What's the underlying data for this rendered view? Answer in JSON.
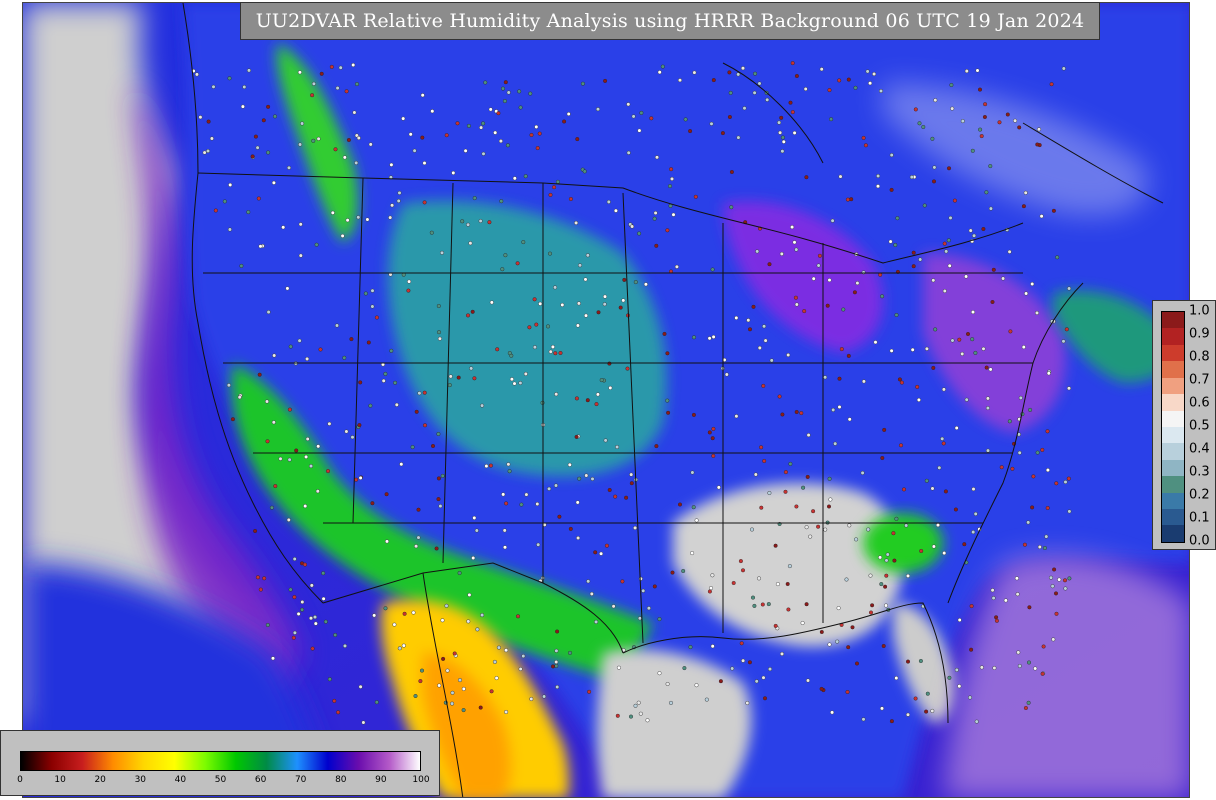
{
  "title": "UU2DVAR Relative Humidity Analysis using HRRR Background 06 UTC 19 Jan 2024",
  "colorbar": {
    "ticks": [
      "0",
      "10",
      "20",
      "30",
      "40",
      "50",
      "60",
      "70",
      "80",
      "90",
      "100"
    ],
    "stops": [
      "#000000",
      "#8b0000",
      "#c81e1e",
      "#ff8c00",
      "#ffd700",
      "#ffff00",
      "#7cfc00",
      "#00c800",
      "#008b45",
      "#1e90ff",
      "#0000cd",
      "#6a0dad",
      "#b45ac8",
      "#ffffff"
    ]
  },
  "legend": {
    "labels": [
      "1.0",
      "0.9",
      "0.8",
      "0.7",
      "0.6",
      "0.5",
      "0.4",
      "0.3",
      "0.2",
      "0.1",
      "0.0"
    ],
    "colors": [
      "#8b1a1a",
      "#b22222",
      "#cd3c2c",
      "#e0704a",
      "#f0a080",
      "#f8d8c8",
      "#f5f5f5",
      "#dbe8f0",
      "#b8d0dc",
      "#8fb5c4",
      "#4f9080",
      "#3a7aa8",
      "#2a5a90",
      "#1a3c70"
    ]
  },
  "colors": {
    "ocean_far": "#c8c8c8",
    "moist_blue": "#1e2cd8",
    "purple": "#8a2be2",
    "teal": "#2aa89a",
    "green": "#22cc22",
    "yellow": "#ffd700",
    "gray_land": "#cfcfcf"
  }
}
